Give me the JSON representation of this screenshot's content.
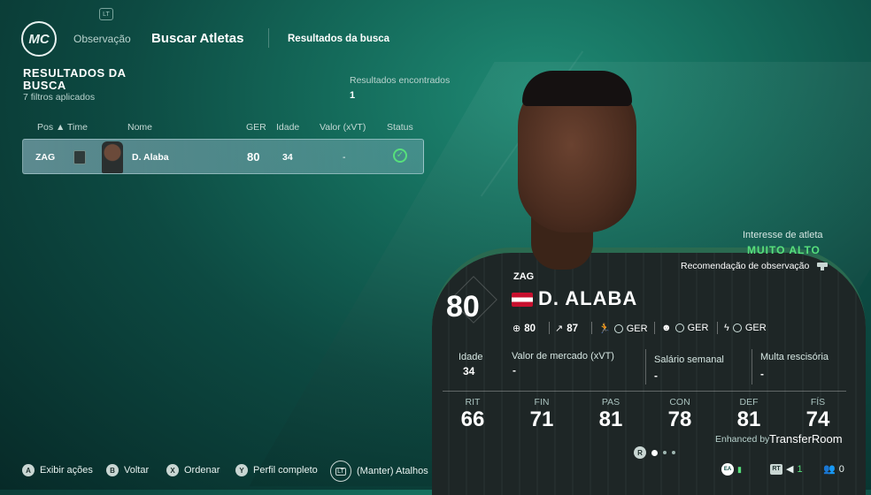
{
  "nav": {
    "logo_text": "MC",
    "lt_chip": "LT",
    "tab_observacao": "Observação",
    "tab_buscar": "Buscar Atletas",
    "tab_resultados": "Resultados da busca"
  },
  "results": {
    "title": "RESULTADOS DA BUSCA",
    "filters": "7 filtros aplicados",
    "found_label": "Resultados encontrados",
    "found_value": "1"
  },
  "table": {
    "headers": [
      "Pos ▲",
      "Time",
      "Nome",
      "GER",
      "Idade",
      "Valor (xVT)",
      "Status"
    ],
    "rows": [
      {
        "pos": "ZAG",
        "name": "D. Alaba",
        "ger": "80",
        "idade": "34",
        "valor": "-",
        "status": "ok"
      }
    ]
  },
  "player": {
    "interest_label": "Interesse de atleta",
    "interest_value": "MUITO ALTO",
    "recommendation": "Recomendação de observação",
    "position": "ZAG",
    "overall": "80",
    "name": "D. ALABA",
    "ovr_small": "80",
    "potential": "87",
    "ger_label": "GER",
    "idade_label": "Idade",
    "idade_value": "34",
    "market_label": "Valor de mercado (xVT)",
    "market_value": "-",
    "salary_label": "Salário semanal",
    "salary_value": "-",
    "release_label": "Multa rescisória",
    "release_value": "-",
    "attributes": [
      {
        "label": "RIT",
        "value": 66
      },
      {
        "label": "FIN",
        "value": 71
      },
      {
        "label": "PAS",
        "value": 81
      },
      {
        "label": "CON",
        "value": 78
      },
      {
        "label": "DEF",
        "value": 81
      },
      {
        "label": "FÍS",
        "value": 74
      }
    ],
    "enhanced_by": "Enhanced by",
    "brand": "TransferRoom",
    "pager_button": "R"
  },
  "hints": {
    "a_glyph": "A",
    "a_label": "Exibir ações",
    "b_glyph": "B",
    "b_label": "Voltar",
    "x_glyph": "X",
    "x_label": "Ordenar",
    "y_glyph": "Y",
    "y_label": "Perfil completo",
    "lt_glyph": "LT",
    "lt_label": "(Manter) Atalhos"
  },
  "system": {
    "ea": "EA",
    "rt": "RT",
    "count_1": "1",
    "count_2": "0"
  },
  "colors": {
    "accent_green": "#57e07c",
    "flag_red": "#c8102e"
  }
}
